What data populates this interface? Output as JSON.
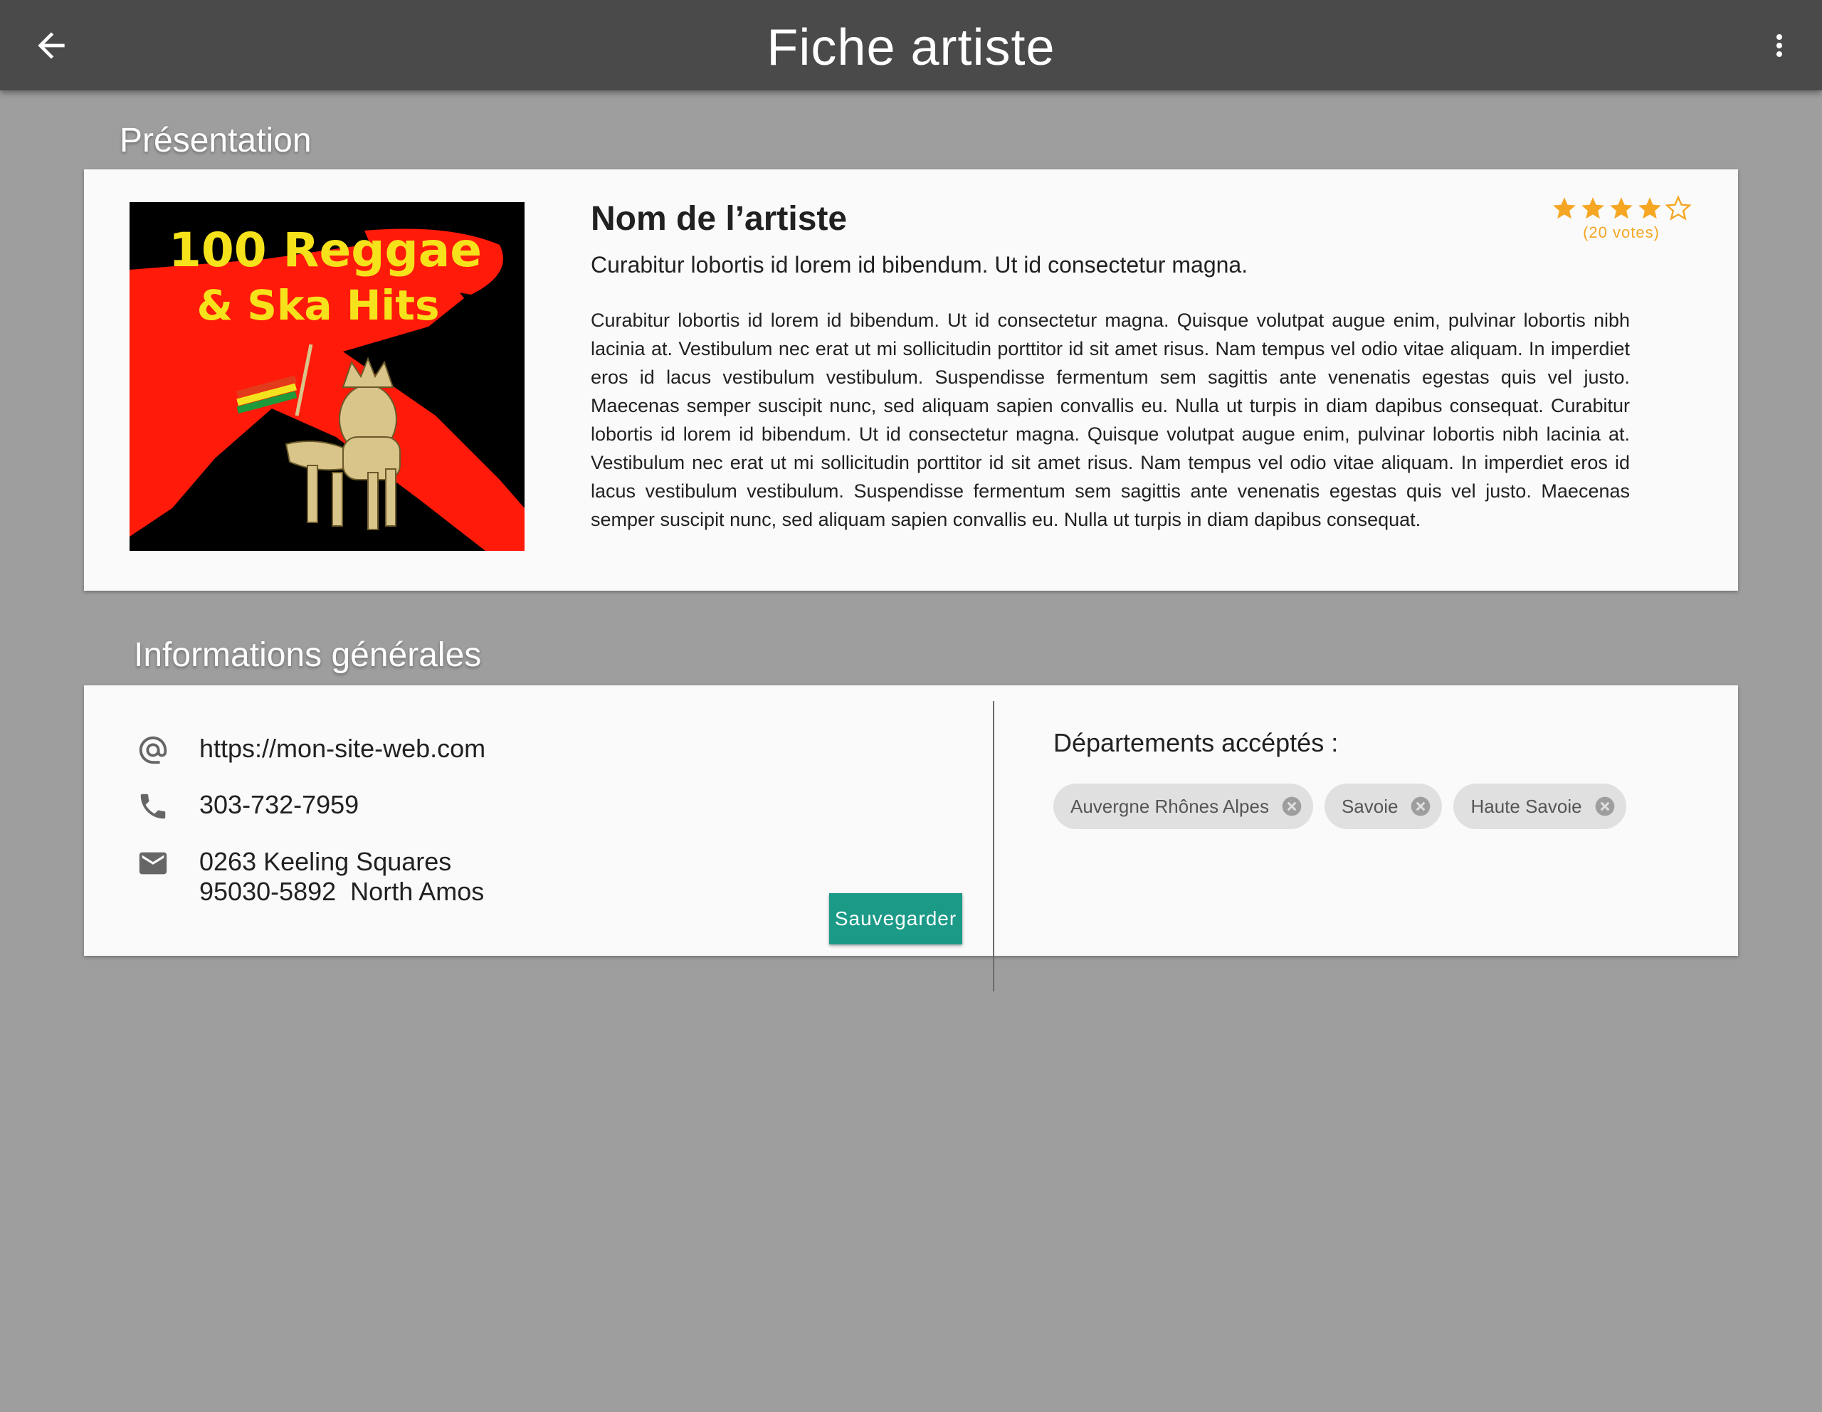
{
  "appbar": {
    "title": "Fiche artiste",
    "back_icon": "arrow-back-icon",
    "menu_icon": "more-vert-icon"
  },
  "presentation": {
    "section_label": "Présentation",
    "cover_text_line1": "100 Reggae",
    "cover_text_line2": "& Ska Hits",
    "artist_name": "Nom de l’artiste",
    "tagline": "Curabitur lobortis id lorem id bibendum. Ut id consectetur magna.",
    "description": "Curabitur lobortis id lorem id bibendum. Ut id consectetur magna. Quisque volutpat augue enim, pulvinar lobortis nibh lacinia at. Vestibulum nec erat ut mi sollicitudin porttitor id sit amet risus. Nam tempus vel odio vitae aliquam. In imperdiet eros id lacus vestibulum vestibulum. Suspendisse fermentum sem sagittis ante venenatis egestas quis vel justo. Maecenas semper suscipit nunc, sed aliquam sapien convallis eu. Nulla ut turpis in diam dapibus consequat. Curabitur lobortis id lorem id bibendum. Ut id consectetur magna. Quisque volutpat augue enim, pulvinar lobortis nibh lacinia at. Vestibulum nec erat ut mi sollicitudin porttitor id sit amet risus. Nam tempus vel odio vitae aliquam. In imperdiet eros id lacus vestibulum vestibulum. Suspendisse fermentum sem sagittis ante venenatis egestas quis vel justo. Maecenas semper suscipit nunc, sed aliquam sapien convallis eu. Nulla ut turpis in diam dapibus consequat.",
    "rating": {
      "value": 4,
      "max": 5,
      "votes_label": "(20 votes)",
      "color": "#f5a623"
    }
  },
  "info": {
    "section_label": "Informations générales",
    "website": "https://mon-site-web.com",
    "phone": "303-732-7959",
    "address_line1": "0263 Keeling Squares",
    "address_line2": "95030-5892  North Amos",
    "save_label": "Sauvegarder",
    "save_color": "#1b9a88",
    "departments_label": "Départements accéptés :",
    "departments": [
      "Auvergne Rhônes Alpes",
      "Savoie",
      "Haute Savoie"
    ]
  }
}
